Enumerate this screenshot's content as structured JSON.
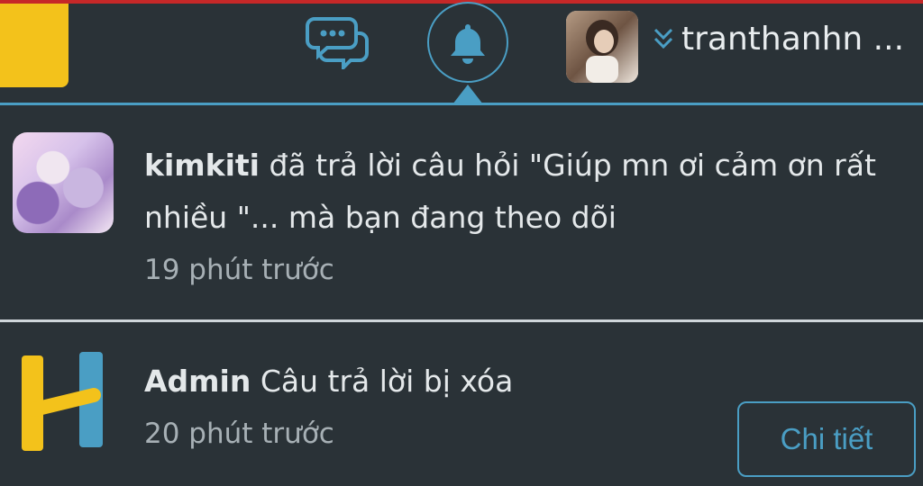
{
  "header": {
    "username": "tranthanhn ...",
    "icons": {
      "chat": "chat-bubbles-icon",
      "bell": "bell-icon",
      "chevron": "double-chevron-down-icon"
    }
  },
  "notifications": [
    {
      "user": "kimkiti",
      "message": " đã trả lời câu hỏi \"Giúp mn ơi cảm ơn rất nhiều \"... mà bạn đang theo dõi",
      "time": "19 phút trước"
    },
    {
      "user": "Admin",
      "message": " Câu trả lời bị xóa",
      "time": "20 phút trước",
      "action_label": "Chi tiết"
    }
  ],
  "colors": {
    "background": "#2a3237",
    "accent": "#4a9ec4",
    "brand_yellow": "#f3c21b",
    "top_bar": "#c62828"
  }
}
